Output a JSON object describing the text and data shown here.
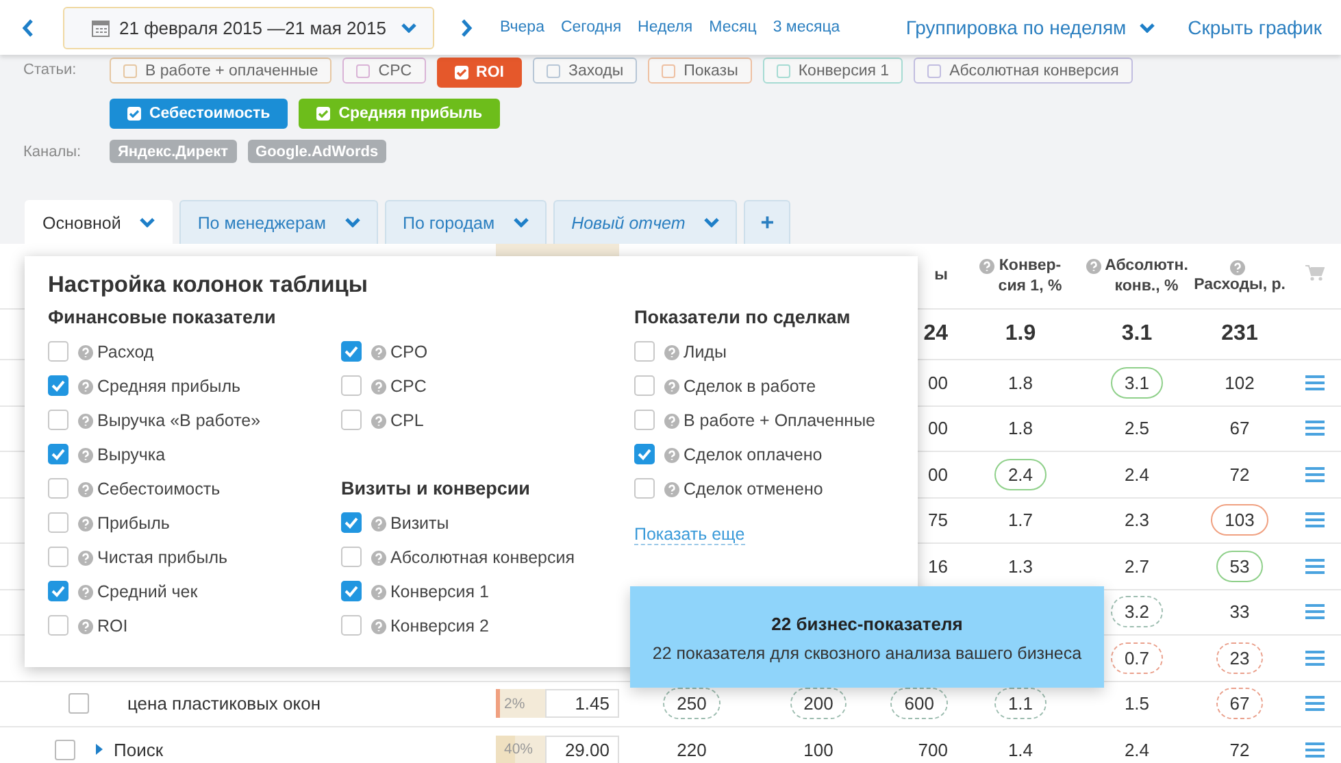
{
  "toolbar": {
    "date_range": "21 февраля 2015 —21 мая 2015",
    "quick_ranges": [
      "Вчера",
      "Сегодня",
      "Неделя",
      "Месяц",
      "3 месяца"
    ],
    "grouping": "Группировка по неделям",
    "hide_chart": "Скрыть график"
  },
  "filters": {
    "articles_label": "Статьи:",
    "articles": [
      {
        "label": "В работе + оплаченные",
        "checked": false,
        "color": "#e6c7a2"
      },
      {
        "label": "CPC",
        "checked": false,
        "color": "#d9b3d6"
      },
      {
        "label": "ROI",
        "checked": true,
        "color": "#e5582b"
      },
      {
        "label": "Заходы",
        "checked": false,
        "color": "#b7c6d6"
      },
      {
        "label": "Показы",
        "checked": false,
        "color": "#eec0a2"
      },
      {
        "label": "Конверсия 1",
        "checked": false,
        "color": "#a6dbd3"
      },
      {
        "label": "Абсолютная конверсия",
        "checked": false,
        "color": "#c1bde0"
      },
      {
        "label": "Себестоимость",
        "checked": true,
        "color": "#1b8ed6"
      },
      {
        "label": "Средняя прибыль",
        "checked": true,
        "color": "#6dbd1b"
      }
    ],
    "channels_label": "Каналы:",
    "channels": [
      "Яндекс.Директ",
      "Google.AdWords"
    ]
  },
  "tabs": [
    {
      "label": "Основной",
      "selected": true,
      "kind": "report"
    },
    {
      "label": "По менеджерам",
      "selected": false,
      "kind": "report"
    },
    {
      "label": "По городам",
      "selected": false,
      "kind": "report"
    },
    {
      "label": "Новый отчет",
      "selected": false,
      "kind": "new"
    },
    {
      "label": "+",
      "selected": false,
      "kind": "add"
    }
  ],
  "table": {
    "header": [
      {
        "text": "ы",
        "help": false
      },
      {
        "text": "Конвер-\nсия 1, %",
        "help": true
      },
      {
        "text": "Абсолютн.\nконв., %",
        "help": true
      },
      {
        "text": "Расходы, р.",
        "help": true
      }
    ],
    "rows": [
      {
        "kind": "total",
        "cells": [
          {
            "text": "24",
            "kind": "plain"
          },
          {
            "text": "1.9",
            "kind": "plain"
          },
          {
            "text": "3.1",
            "kind": "plain"
          },
          {
            "text": "231",
            "kind": "plain"
          }
        ]
      },
      {
        "kind": "partial",
        "cells": [
          {
            "text": "00",
            "kind": "plain"
          },
          {
            "text": "1.8",
            "kind": "plain"
          },
          {
            "text": "3.1",
            "kind": "good"
          },
          {
            "text": "102",
            "kind": "plain"
          }
        ]
      },
      {
        "kind": "partial",
        "cells": [
          {
            "text": "00",
            "kind": "plain"
          },
          {
            "text": "1.8",
            "kind": "plain"
          },
          {
            "text": "2.5",
            "kind": "plain"
          },
          {
            "text": "67",
            "kind": "plain"
          }
        ]
      },
      {
        "kind": "partial",
        "cells": [
          {
            "text": "00",
            "kind": "plain"
          },
          {
            "text": "2.4",
            "kind": "good"
          },
          {
            "text": "2.4",
            "kind": "plain"
          },
          {
            "text": "72",
            "kind": "plain"
          }
        ]
      },
      {
        "kind": "partial",
        "cells": [
          {
            "text": "75",
            "kind": "plain"
          },
          {
            "text": "1.7",
            "kind": "plain"
          },
          {
            "text": "2.3",
            "kind": "plain"
          },
          {
            "text": "103",
            "kind": "bad"
          }
        ]
      },
      {
        "kind": "partial",
        "cells": [
          {
            "text": "16",
            "kind": "plain"
          },
          {
            "text": "1.3",
            "kind": "plain"
          },
          {
            "text": "2.7",
            "kind": "plain"
          },
          {
            "text": "53",
            "kind": "good"
          }
        ]
      },
      {
        "kind": "partial",
        "cells": [
          {
            "text": "3.2",
            "kind": "dashed"
          },
          {
            "text": "33",
            "kind": "plain"
          }
        ]
      },
      {
        "kind": "partial",
        "cells": [
          {
            "text": "0.7",
            "kind": "dashed_bad"
          },
          {
            "text": "23",
            "kind": "dashed_bad"
          }
        ]
      },
      {
        "kind": "keyword",
        "name": "цена пластиковых окон",
        "checked": false,
        "progress": {
          "label": "2%",
          "level": 0.02,
          "value": "1.45"
        },
        "cells": [
          {
            "text": "250",
            "kind": "dashed"
          },
          {
            "text": "200",
            "kind": "dashed"
          },
          {
            "text": "600",
            "kind": "dashed"
          },
          {
            "text": "1.1",
            "kind": "dashed"
          },
          {
            "text": "1.5",
            "kind": "plain"
          },
          {
            "text": "67",
            "kind": "dashed_bad"
          }
        ]
      },
      {
        "kind": "group",
        "name": "Поиск",
        "checked": false,
        "progress": {
          "label": "40%",
          "level": 0.4,
          "value": "29.00"
        },
        "cells": [
          {
            "text": "220",
            "kind": "plain"
          },
          {
            "text": "100",
            "kind": "plain"
          },
          {
            "text": "700",
            "kind": "plain"
          },
          {
            "text": "1.4",
            "kind": "plain"
          },
          {
            "text": "2.4",
            "kind": "plain"
          },
          {
            "text": "72",
            "kind": "plain"
          }
        ]
      }
    ]
  },
  "column_settings": {
    "title": "Настройка колонок таблицы",
    "columns": [
      {
        "groups": [
          {
            "heading": "Финансовые показатели",
            "items": [
              {
                "label": "Расход",
                "checked": false
              },
              {
                "label": "Средняя прибыль",
                "checked": true
              },
              {
                "label": "Выручка «В работе»",
                "checked": false
              },
              {
                "label": "Выручка",
                "checked": true
              },
              {
                "label": "Себестоимость",
                "checked": false
              },
              {
                "label": "Прибыль",
                "checked": false
              },
              {
                "label": "Чистая прибыль",
                "checked": false
              },
              {
                "label": "Средний чек",
                "checked": true
              },
              {
                "label": "ROI",
                "checked": false
              }
            ]
          }
        ]
      },
      {
        "groups": [
          {
            "items": [
              {
                "label": "CPO",
                "checked": true
              },
              {
                "label": "CPC",
                "checked": false
              },
              {
                "label": "CPL",
                "checked": false
              }
            ]
          },
          {
            "heading": "Визиты и конверсии",
            "items": [
              {
                "label": "Визиты",
                "checked": true
              },
              {
                "label": "Абсолютная конверсия",
                "checked": false
              },
              {
                "label": "Конверсия 1",
                "checked": true
              },
              {
                "label": "Конверсия 2",
                "checked": false
              }
            ]
          }
        ]
      },
      {
        "groups": [
          {
            "heading": "Показатели по сделкам",
            "items": [
              {
                "label": "Лиды",
                "checked": false
              },
              {
                "label": "Сделок в работе",
                "checked": false
              },
              {
                "label": "В работе + Оплаченные",
                "checked": false
              },
              {
                "label": "Сделок оплачено",
                "checked": true
              },
              {
                "label": "Сделок отменено",
                "checked": false
              }
            ]
          }
        ],
        "more_link": "Показать еще"
      }
    ]
  },
  "tooltip": {
    "title": "22 бизнес-показателя",
    "text": "22 показателя для сквозного анализа вашего бизнеса"
  }
}
